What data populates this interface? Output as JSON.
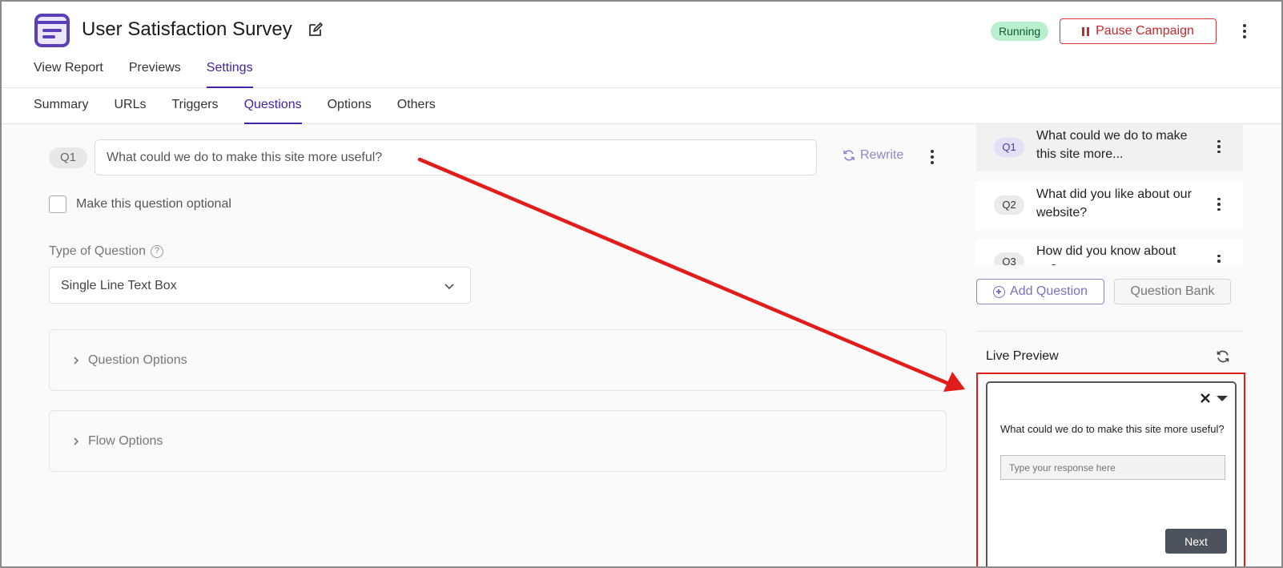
{
  "header": {
    "title": "User Satisfaction Survey",
    "status": "Running",
    "pause_label": "Pause Campaign"
  },
  "top_tabs": [
    {
      "label": "View Report"
    },
    {
      "label": "Previews"
    },
    {
      "label": "Settings",
      "active": true
    }
  ],
  "sub_tabs": [
    {
      "label": "Summary"
    },
    {
      "label": "URLs"
    },
    {
      "label": "Triggers"
    },
    {
      "label": "Questions",
      "active": true
    },
    {
      "label": "Options"
    },
    {
      "label": "Others"
    }
  ],
  "editor": {
    "question_badge": "Q1",
    "question_text": "What could we do to make this site more useful?",
    "rewrite_label": "Rewrite",
    "optional_label": "Make this question optional",
    "optional_checked": false,
    "type_label": "Type of Question",
    "type_value": "Single Line Text Box",
    "question_options_label": "Question Options",
    "flow_options_label": "Flow Options"
  },
  "question_list": [
    {
      "badge": "Q1",
      "text": "What could we do to make this site more...",
      "active": true
    },
    {
      "badge": "Q2",
      "text": "What did you like about our website?"
    },
    {
      "badge": "Q3",
      "text": "How did you know about us?"
    }
  ],
  "actions": {
    "add_question_label": "Add Question",
    "question_bank_label": "Question Bank"
  },
  "live_preview": {
    "title": "Live Preview",
    "question": "What could we do to make this site more useful?",
    "placeholder": "Type your response here",
    "next_label": "Next"
  },
  "colors": {
    "accent": "#4322a6",
    "danger": "#d9383a",
    "running_bg": "#b9efcf",
    "annotation": "#e21b1b"
  }
}
